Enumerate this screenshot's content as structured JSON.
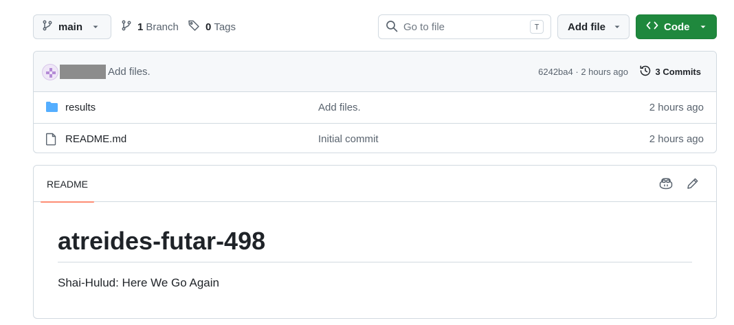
{
  "toolbar": {
    "branch_button_label": "main",
    "branch_count": "1",
    "branch_label": "Branch",
    "tag_count": "0",
    "tag_label": "Tags",
    "search_placeholder": "Go to file",
    "search_shortcut": "T",
    "add_file_label": "Add file",
    "code_label": "Code"
  },
  "latest_commit": {
    "message": "Add files.",
    "hash": "6242ba4",
    "separator": " · ",
    "time": "2 hours ago",
    "commits_count_label": "3 Commits"
  },
  "files": [
    {
      "name": "results",
      "type": "folder",
      "message": "Add files.",
      "age": "2 hours ago"
    },
    {
      "name": "README.md",
      "type": "file",
      "message": "Initial commit",
      "age": "2 hours ago"
    }
  ],
  "readme": {
    "tab_label": "README",
    "title": "atreides-futar-498",
    "text": "Shai-Hulud: Here We Go Again"
  },
  "colors": {
    "code_button": "#1f883d",
    "folder_icon": "#54aeff",
    "tab_underline": "#fd8c73"
  },
  "icons": {
    "branch": "git-branch-icon",
    "tag": "tag-icon",
    "search": "search-icon",
    "code": "code-icon",
    "history": "history-icon",
    "folder": "folder-icon",
    "file": "file-icon",
    "copilot": "copilot-icon",
    "edit": "pencil-icon"
  }
}
